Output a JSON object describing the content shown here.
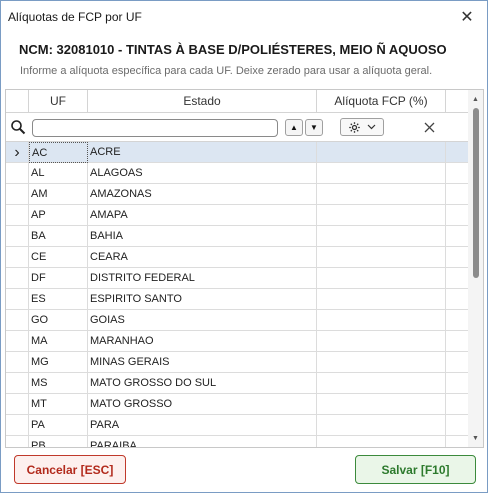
{
  "window": {
    "title": "Alíquotas de FCP por UF",
    "close_glyph": "✕"
  },
  "header": {
    "ncm_title": "NCM: 32081010 - TINTAS À BASE D/POLIÉSTERES, MEIO Ñ AQUOSO",
    "subtitle": "Informe a alíquota específica para cada UF. Deixe zerado para usar a alíquota geral."
  },
  "grid": {
    "columns": [
      "UF",
      "Estado",
      "Alíquota FCP (%)"
    ],
    "filter": {
      "value": "",
      "placeholder": ""
    },
    "icons": {
      "search": "search-icon",
      "sort_up": "triangle-up-icon",
      "sort_down": "triangle-down-icon",
      "settings": "gear-icon",
      "clear": "close-icon"
    },
    "selected_row": 0,
    "rows": [
      {
        "uf": "AC",
        "estado": "ACRE",
        "aliquota": ""
      },
      {
        "uf": "AL",
        "estado": "ALAGOAS",
        "aliquota": ""
      },
      {
        "uf": "AM",
        "estado": "AMAZONAS",
        "aliquota": ""
      },
      {
        "uf": "AP",
        "estado": "AMAPA",
        "aliquota": ""
      },
      {
        "uf": "BA",
        "estado": "BAHIA",
        "aliquota": ""
      },
      {
        "uf": "CE",
        "estado": "CEARA",
        "aliquota": ""
      },
      {
        "uf": "DF",
        "estado": "DISTRITO FEDERAL",
        "aliquota": ""
      },
      {
        "uf": "ES",
        "estado": "ESPIRITO SANTO",
        "aliquota": ""
      },
      {
        "uf": "GO",
        "estado": "GOIAS",
        "aliquota": ""
      },
      {
        "uf": "MA",
        "estado": "MARANHAO",
        "aliquota": ""
      },
      {
        "uf": "MG",
        "estado": "MINAS GERAIS",
        "aliquota": ""
      },
      {
        "uf": "MS",
        "estado": "MATO GROSSO DO SUL",
        "aliquota": ""
      },
      {
        "uf": "MT",
        "estado": "MATO GROSSO",
        "aliquota": ""
      },
      {
        "uf": "PA",
        "estado": "PARA",
        "aliquota": ""
      },
      {
        "uf": "PB",
        "estado": "PARAIBA",
        "aliquota": ""
      }
    ]
  },
  "footer": {
    "cancel_label": "Cancelar [ESC]",
    "save_label": "Salvar [F10]"
  },
  "colors": {
    "cancel": "#b22a1c",
    "save": "#2d7a2d",
    "selection": "#dce6f2"
  }
}
